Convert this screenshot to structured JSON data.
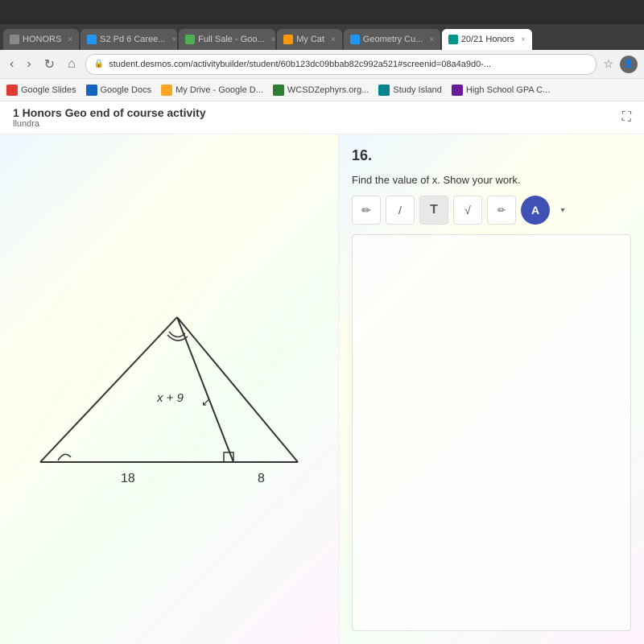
{
  "browser": {
    "tabs": [
      {
        "id": "honors",
        "label": "HONORS",
        "active": false,
        "favicon_color": "gray"
      },
      {
        "id": "s2pd6",
        "label": "S2 Pd 6 Caree...",
        "active": false,
        "favicon_color": "blue"
      },
      {
        "id": "fullsale",
        "label": "Full Sale - Goo...",
        "active": false,
        "favicon_color": "green"
      },
      {
        "id": "mycat",
        "label": "My Cat",
        "active": false,
        "favicon_color": "orange"
      },
      {
        "id": "geocur",
        "label": "Geometry Cu...",
        "active": false,
        "favicon_color": "blue"
      },
      {
        "id": "20-21honors",
        "label": "20/21 Honors",
        "active": true,
        "favicon_color": "teal"
      }
    ],
    "url": "student.desmos.com/activitybuilder/student/60b123dc09bbab82c992a521#screenid=08a4a9d0-...",
    "url_prefix": "🔒"
  },
  "bookmarks": [
    {
      "id": "google-slides",
      "label": "Google Slides",
      "color": "red"
    },
    {
      "id": "google-docs",
      "label": "Google Docs",
      "color": "blue"
    },
    {
      "id": "my-drive",
      "label": "My Drive - Google D...",
      "color": "yellow"
    },
    {
      "id": "wcsd",
      "label": "WCSDZephyrs.org...",
      "color": "green"
    },
    {
      "id": "study-island",
      "label": "Study Island",
      "color": "teal"
    },
    {
      "id": "school-gpa",
      "label": "High School GPA C...",
      "color": "purple"
    }
  ],
  "page": {
    "title": "1 Honors Geo end of course activity",
    "subtitle": "llundra",
    "expand_icon": "⛶"
  },
  "question": {
    "number": "16.",
    "text": "Find the value of x. Show your work.",
    "toolbar": {
      "pencil_label": "✏",
      "line_label": "/",
      "text_label": "T",
      "sqrt_label": "√",
      "eraser_label": "✏",
      "color_label": "A"
    }
  },
  "triangle": {
    "label_hypotenuse": "x + 9",
    "label_base_left": "18",
    "label_base_right": "8"
  }
}
